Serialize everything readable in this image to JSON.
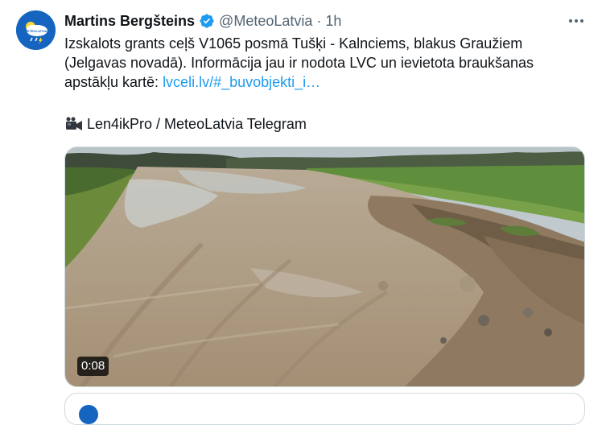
{
  "tweet": {
    "author_name": "Martins Bergšteins",
    "author_handle": "@MeteoLatvia",
    "separator": "·",
    "time": "1h",
    "text_line1": "Izskalots grants ceļš V1065 posmā Tušķi - Kalnciems, blakus Graužiem",
    "text_line2": "(Jelgavas novadā). Informācija jau ir nodota LVC un ievietota braukšanas",
    "text_line3": "apstākļu kartē: ",
    "link_text": "lvceli.lv/#_buvobjekti_i…",
    "credit": "Len4ikPro / MeteoLatvia Telegram",
    "video_duration": "0:08",
    "avatar_label": "METEOLATVIA"
  },
  "colors": {
    "link": "#1d9bf0",
    "verified": "#1d9bf0",
    "secondary_text": "#536471",
    "avatar_bg": "#1565c0"
  },
  "icons": {
    "verified": "verified-badge-icon",
    "more": "more-horizontal-icon",
    "camera": "video-camera-icon"
  }
}
